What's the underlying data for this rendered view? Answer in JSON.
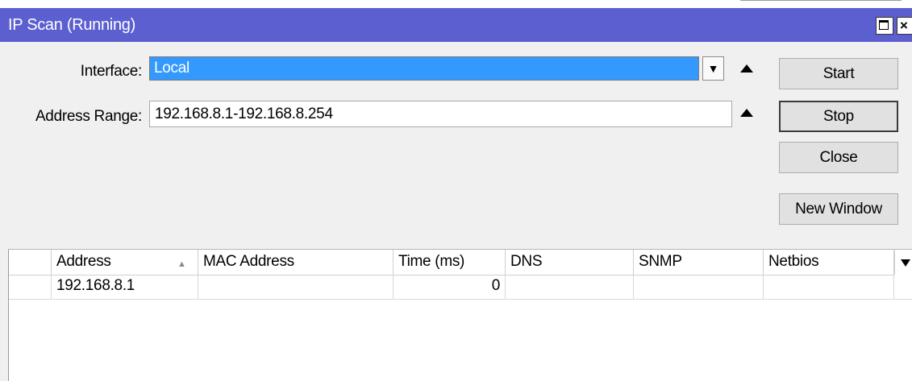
{
  "window": {
    "title": "IP Scan (Running)"
  },
  "form": {
    "interface_label": "Interface:",
    "interface_value": "Local",
    "address_range_label": "Address Range:",
    "address_range_value": "192.168.8.1-192.168.8.254"
  },
  "buttons": {
    "start": "Start",
    "stop": "Stop",
    "close": "Close",
    "new_window": "New Window"
  },
  "table": {
    "columns": [
      "Address",
      "MAC Address",
      "Time (ms)",
      "DNS",
      "SNMP",
      "Netbios"
    ],
    "rows": [
      {
        "address": "192.168.8.1",
        "mac": "",
        "time": "0",
        "dns": "",
        "snmp": "",
        "netbios": ""
      }
    ]
  },
  "colors": {
    "titlebar": "#5c5fd0",
    "selection": "#3399ff"
  }
}
